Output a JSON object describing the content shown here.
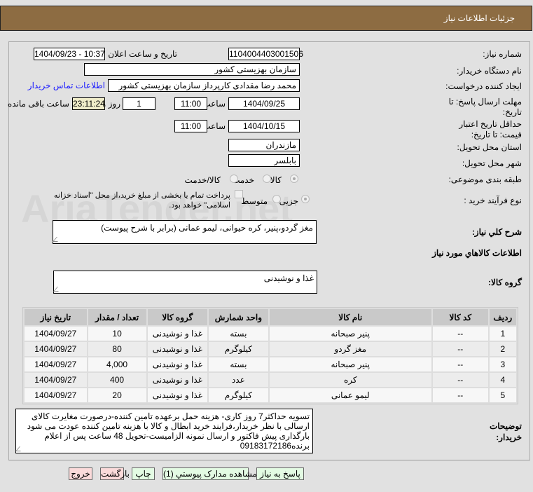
{
  "header": {
    "title": "جزئیات اطلاعات نیاز"
  },
  "form": {
    "need_number_label": "شماره نیاز:",
    "need_number": "1104004403001506",
    "announce_label": "تاریخ و ساعت اعلان عمومی:",
    "announce_value": "1404/09/23 - 10:37",
    "buyer_org_label": "نام دستگاه خریدار:",
    "buyer_org": "سازمان بهزیستی کشور",
    "creator_label": "ایجاد کننده درخواست:",
    "creator": "محمد رضا  مقدادی کارپرداز سازمان بهزیستی کشور",
    "contact_link": "اطلاعات تماس خریدار",
    "deadline_label": "مهلت ارسال پاسخ: تا تاریخ:",
    "deadline_date": "1404/09/25",
    "hour_label": "ساعت",
    "deadline_time": "11:00",
    "days": "1",
    "days_label": "روز و",
    "remaining": "23:11:24",
    "remaining_label": "ساعت باقی مانده",
    "validity_label": "حداقل تاریخ اعتبار قیمت: تا تاریخ:",
    "validity_date": "1404/10/15",
    "validity_time": "11:00",
    "province_label": "استان محل تحویل:",
    "province": "مازندران",
    "city_label": "شهر محل تحویل:",
    "city": "بابلسر",
    "category_label": "طبقه بندی موضوعی:",
    "category_options": [
      "کالا",
      "خدمت",
      "کالا/خدمت"
    ],
    "process_label": "نوع فرآیند خرید :",
    "process_options": [
      "جزیی",
      "متوسط"
    ],
    "treasury_text": "پرداخت تمام یا بخشی از مبلغ خرید،از محل \"اسناد خزانه اسلامی\" خواهد بود.",
    "description_label": "شرح کلي نیاز:",
    "description": "مغز گردو،پنیر، کره حیوانی، لیمو عمانی (برابر با شرح پیوست)",
    "goods_info_title": "اطلاعات کالاهاي مورد نیاز",
    "goods_group_label": "گروه کالا:",
    "goods_group": "غذا و نوشیدنی",
    "notes_label": "توضیحات خریدار:",
    "notes": "تسویه حداکثر7 روز کاری- هزینه حمل برعهده تامین کننده-درصورت مغایرت کالای ارسالی با نظر خریدار،فرایند خرید ابطال و کالا با هزینه تامین کننده عودت می شود بارگذاری پیش فاکتور و ارسال نمونه الزامیست-تحویل 48 ساعت پس از اعلام برنده09183172186"
  },
  "table": {
    "headers": [
      "ردیف",
      "کد کالا",
      "نام کالا",
      "واحد شمارش",
      "گروه کالا",
      "تعداد / مقدار",
      "تاریخ نیاز"
    ],
    "rows": [
      [
        "1",
        "--",
        "پنیر صبحانه",
        "بسته",
        "غذا و نوشیدنی",
        "10",
        "1404/09/27"
      ],
      [
        "2",
        "--",
        "مغز گردو",
        "کیلوگرم",
        "غذا و نوشیدنی",
        "80",
        "1404/09/27"
      ],
      [
        "3",
        "--",
        "پنیر صبحانه",
        "بسته",
        "غذا و نوشیدنی",
        "4,000",
        "1404/09/27"
      ],
      [
        "4",
        "--",
        "کره",
        "عدد",
        "غذا و نوشیدنی",
        "400",
        "1404/09/27"
      ],
      [
        "5",
        "--",
        "لیمو عمانی",
        "کیلوگرم",
        "غذا و نوشیدنی",
        "20",
        "1404/09/27"
      ]
    ]
  },
  "buttons": {
    "reply": "پاسخ به نیاز",
    "attachments": "مشاهده مدارک پیوستي (1)",
    "print": "چاپ",
    "back": "بازگشت",
    "exit": "خروج"
  },
  "watermark": "AriaTender.net"
}
